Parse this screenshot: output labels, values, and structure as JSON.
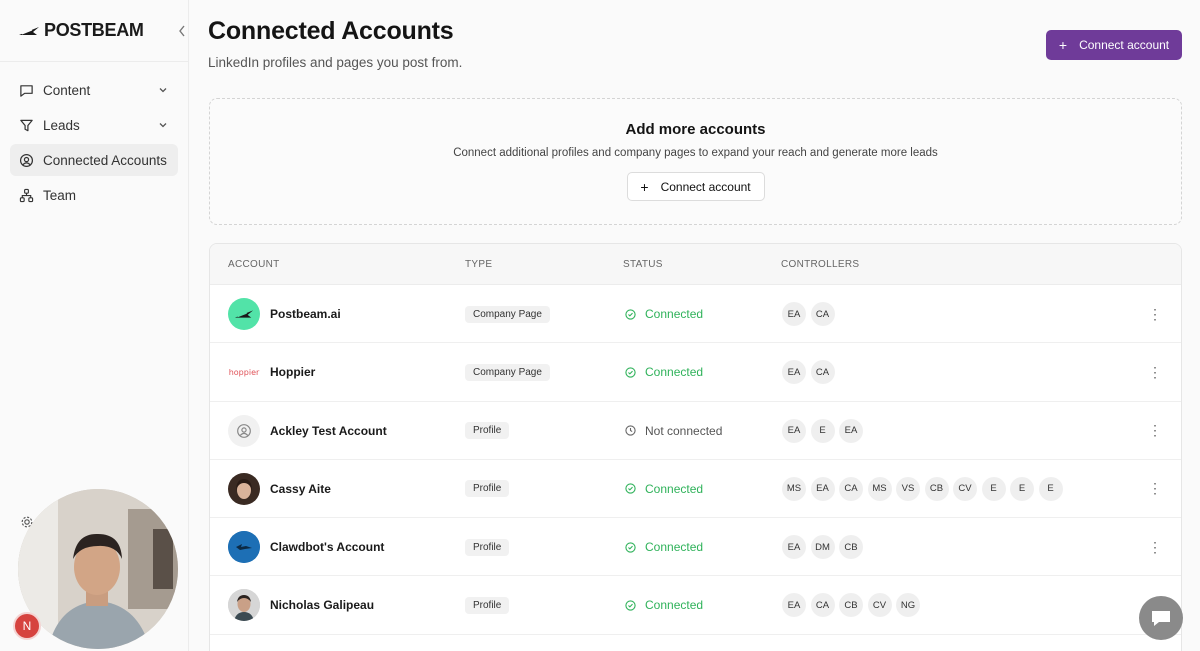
{
  "brand": {
    "name": "POSTBEAM"
  },
  "sidebar": {
    "items": [
      {
        "label": "Content",
        "icon": "message-square-icon",
        "has_chevron": true
      },
      {
        "label": "Leads",
        "icon": "filter-icon",
        "has_chevron": true
      },
      {
        "label": "Connected Accounts",
        "icon": "user-circle-icon",
        "active": true
      },
      {
        "label": "Team",
        "icon": "network-icon"
      }
    ],
    "user_initial": "N"
  },
  "header": {
    "title": "Connected Accounts",
    "subtitle": "LinkedIn profiles and pages you post from.",
    "connect_button": "Connect account"
  },
  "add_more": {
    "title": "Add more accounts",
    "description": "Connect additional profiles and company pages to expand your reach and generate more leads",
    "button": "Connect account"
  },
  "table": {
    "columns": [
      "ACCOUNT",
      "TYPE",
      "STATUS",
      "CONTROLLERS"
    ],
    "rows": [
      {
        "name": "Postbeam.ai",
        "type": "Company Page",
        "status": "Connected",
        "controllers": [
          "EA",
          "CA"
        ]
      },
      {
        "name": "Hoppier",
        "type": "Company Page",
        "status": "Connected",
        "controllers": [
          "EA",
          "CA"
        ]
      },
      {
        "name": "Ackley Test Account",
        "type": "Profile",
        "status": "Not connected",
        "controllers": [
          "EA",
          "E",
          "EA"
        ]
      },
      {
        "name": "Cassy Aite",
        "type": "Profile",
        "status": "Connected",
        "controllers": [
          "MS",
          "EA",
          "CA",
          "MS",
          "VS",
          "CB",
          "CV",
          "E",
          "E",
          "E"
        ]
      },
      {
        "name": "Clawdbot's Account",
        "type": "Profile",
        "status": "Connected",
        "controllers": [
          "EA",
          "DM",
          "CB"
        ]
      },
      {
        "name": "Nicholas Galipeau",
        "type": "Profile",
        "status": "Connected",
        "controllers": [
          "EA",
          "CA",
          "CB",
          "CV",
          "NG"
        ]
      }
    ]
  },
  "logos": {
    "hoppier": "hoppier"
  },
  "colors": {
    "accent": "#6f3b99",
    "connected": "#2fb25a",
    "postbeam_bg": "#52e3a8"
  }
}
